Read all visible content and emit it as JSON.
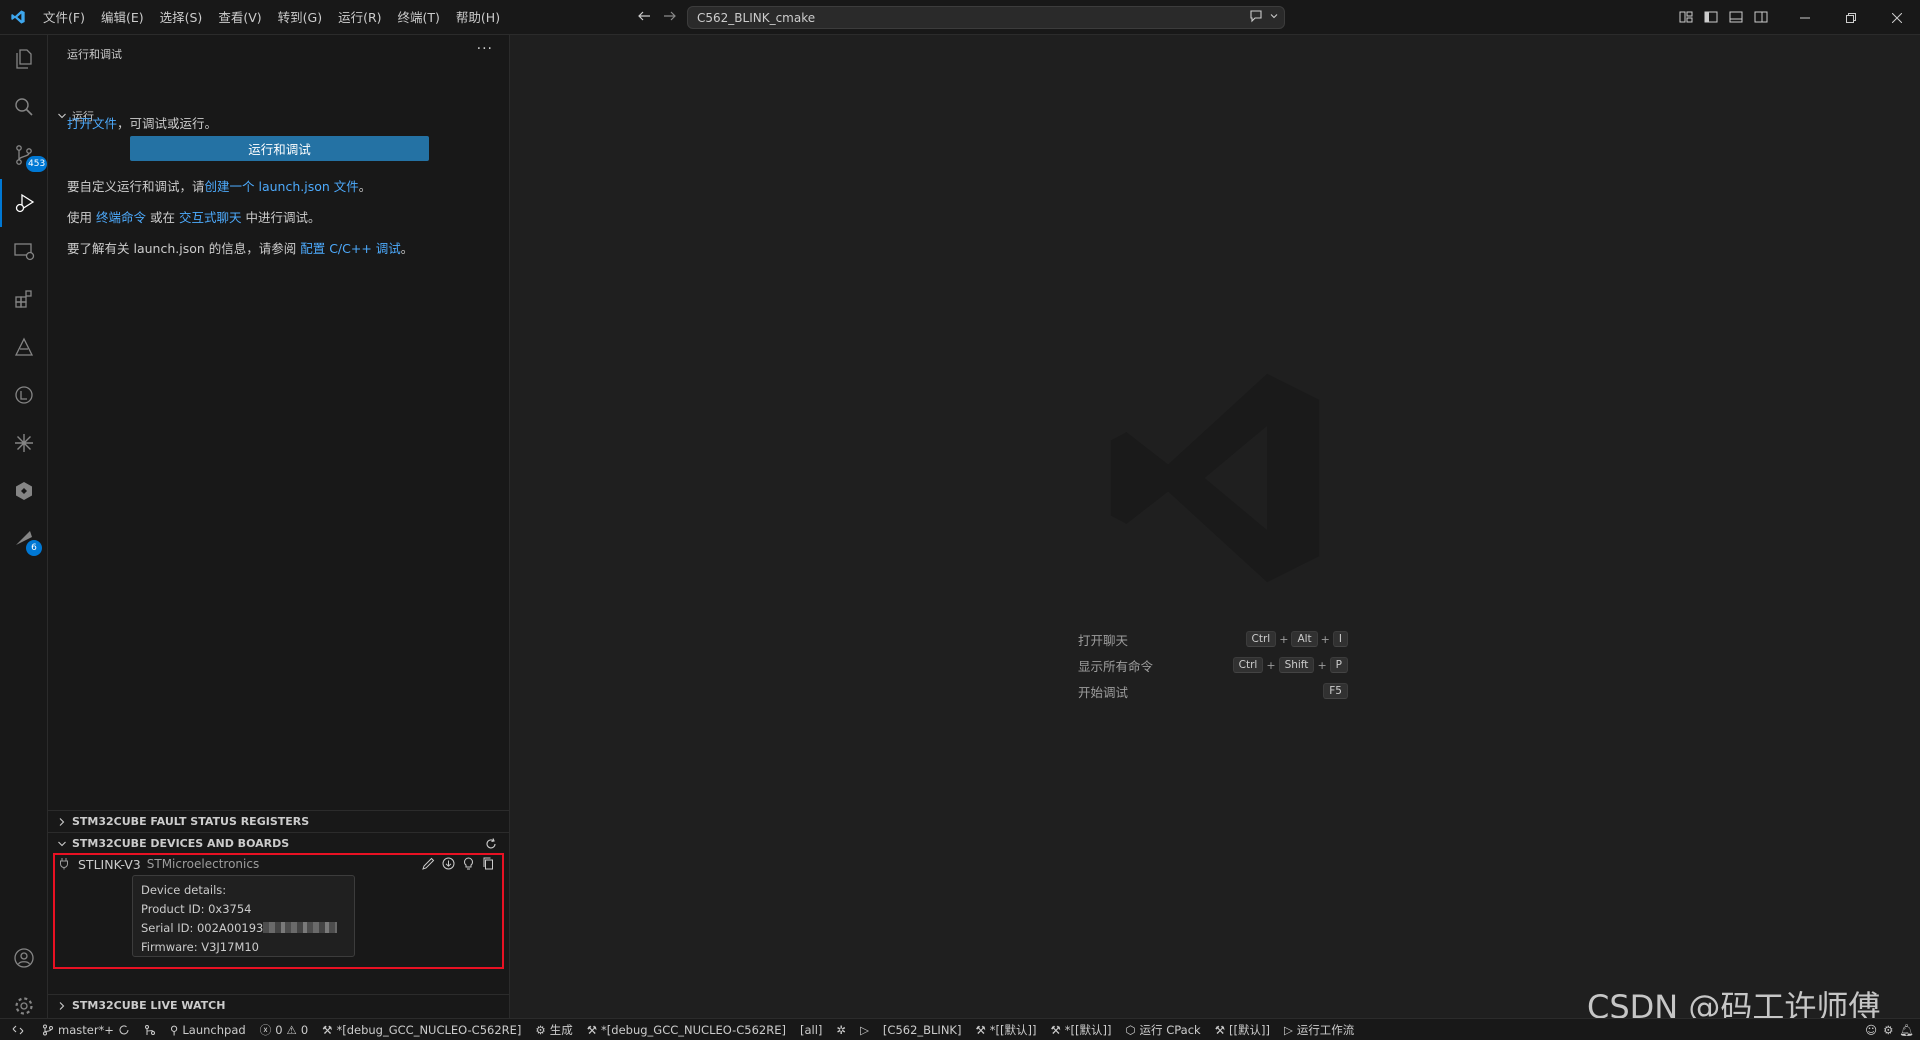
{
  "titlebar": {
    "menus": [
      "文件(F)",
      "编辑(E)",
      "选择(S)",
      "查看(V)",
      "转到(G)",
      "运行(R)",
      "终端(T)",
      "帮助(H)"
    ],
    "search_text": "C562_BLINK_cmake"
  },
  "activitybar": {
    "source_control_badge": "453",
    "stm32_badge": "6"
  },
  "sidebar": {
    "title": "运行和调试",
    "more": "···",
    "run_section": "运行",
    "open_file_link": "打开文件",
    "open_file_rest": "，可调试或运行。",
    "run_button": "运行和调试",
    "customize_prefix": "要自定义运行和调试，请",
    "customize_link": "创建一个 launch.json 文件",
    "customize_suffix": "。",
    "use_prefix": "使用 ",
    "terminal_link": "终端命令",
    "or_text": " 或在 ",
    "chat_link": "交互式聊天",
    "use_suffix": " 中进行调试。",
    "learn_prefix": "要了解有关 launch.json 的信息，请参阅 ",
    "config_link": "配置 C/C++ 调试",
    "learn_suffix": "。",
    "section_fault": "STM32CUBE FAULT STATUS REGISTERS",
    "section_devices": "STM32CUBE DEVICES AND BOARDS",
    "section_watch": "STM32CUBE LIVE WATCH",
    "device": {
      "name": "STLINK-V3",
      "vendor": "STMicroelectronics",
      "tooltip": {
        "details": "Device details:",
        "product": "Product ID: 0x3754",
        "serial": "Serial ID: 002A00193",
        "firmware": "Firmware: V3J17M10"
      }
    }
  },
  "editor": {
    "shortcuts": [
      {
        "label": "打开聊天",
        "keys": [
          "Ctrl",
          "Alt",
          "I"
        ]
      },
      {
        "label": "显示所有命令",
        "keys": [
          "Ctrl",
          "Shift",
          "P"
        ]
      },
      {
        "label": "开始调试",
        "keys": [
          "F5"
        ]
      }
    ]
  },
  "watermark": "CSDN @码工许师傅",
  "statusbar": {
    "branch": "master*+",
    "launchpad": "Launchpad",
    "errors": "0",
    "warnings": "0",
    "config1": "*[debug_GCC_NUCLEO-C562RE]",
    "build": "生成",
    "config2": "*[debug_GCC_NUCLEO-C562RE]",
    "target_all": "[all]",
    "project": "[C562_BLINK]",
    "default1": "*[[默认]]",
    "default2": "*[[默认]]",
    "run_cpack": "运行 CPack",
    "default3": "[[默认]]",
    "run_workflow": "运行工作流"
  },
  "colors": {
    "accent": "#0078d4",
    "link": "#4daafc",
    "button": "#2472a4",
    "highlight_box": "#e81123"
  }
}
